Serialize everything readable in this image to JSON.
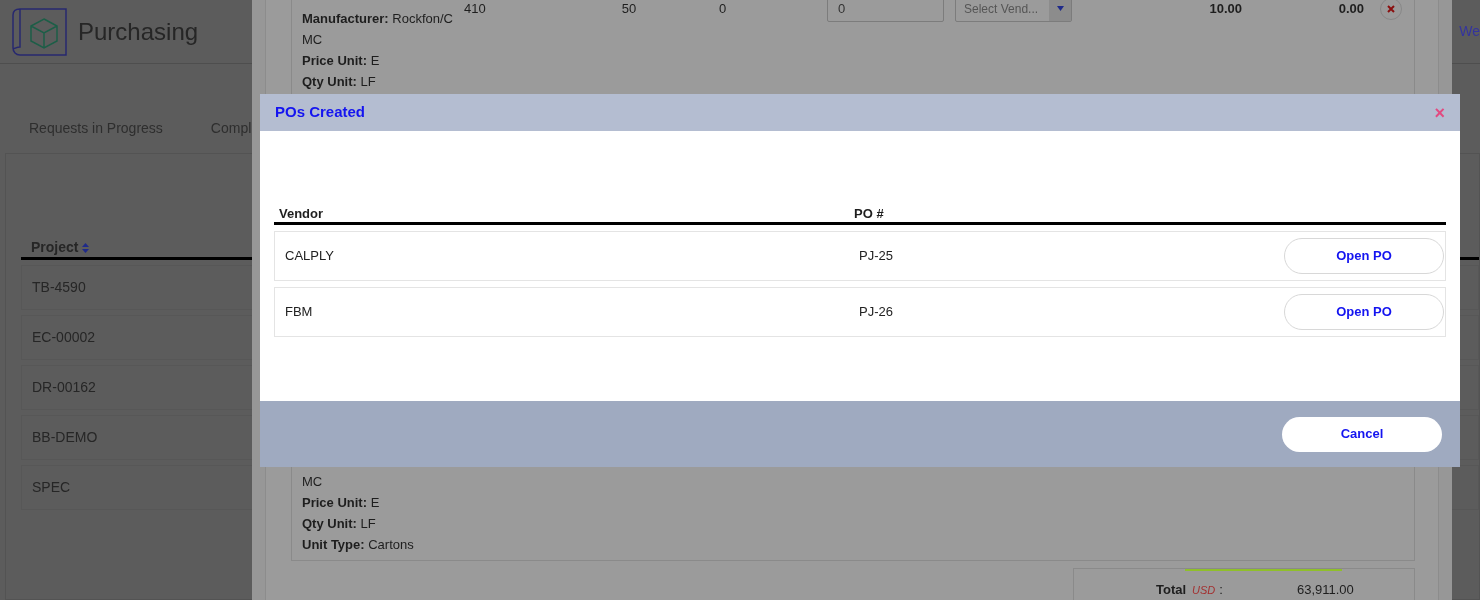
{
  "header": {
    "title": "Purchasing",
    "link": "We"
  },
  "tabs": [
    {
      "label": "Requests in Progress"
    },
    {
      "label": "Compl"
    }
  ],
  "projects": {
    "column": "Project",
    "rows": [
      "TB-4590",
      "EC-00002",
      "DR-00162",
      "BB-DEMO",
      "SPEC"
    ]
  },
  "line_items": [
    {
      "details": [
        {
          "label": "Manufacturer:",
          "value": "Rockfon/C"
        },
        {
          "value": "MC"
        },
        {
          "label": "Price Unit:",
          "value": "E"
        },
        {
          "label": "Qty Unit:",
          "value": "LF"
        }
      ],
      "qty": "410",
      "column_2": "50",
      "column_3": "0",
      "input": "0",
      "vendor_select": "Select Vend...",
      "price": "10.00",
      "amount": "0.00",
      "removable": true
    },
    {
      "details": [
        {
          "value": "MC"
        },
        {
          "label": "Price Unit:",
          "value": "E"
        },
        {
          "label": "Qty Unit:",
          "value": "LF"
        },
        {
          "label": "Unit Type:",
          "value": "Cartons"
        }
      ]
    }
  ],
  "total": {
    "label": "Total",
    "currency": "USD",
    "separator": ":",
    "amount": "63,911.00"
  },
  "modal": {
    "title": "POs Created",
    "close": "×",
    "columns": [
      "Vendor",
      "PO #"
    ],
    "rows": [
      {
        "vendor": "CALPLY",
        "po": "PJ-25",
        "action": "Open PO"
      },
      {
        "vendor": "FBM",
        "po": "PJ-26",
        "action": "Open PO"
      }
    ],
    "cancel": "Cancel"
  }
}
